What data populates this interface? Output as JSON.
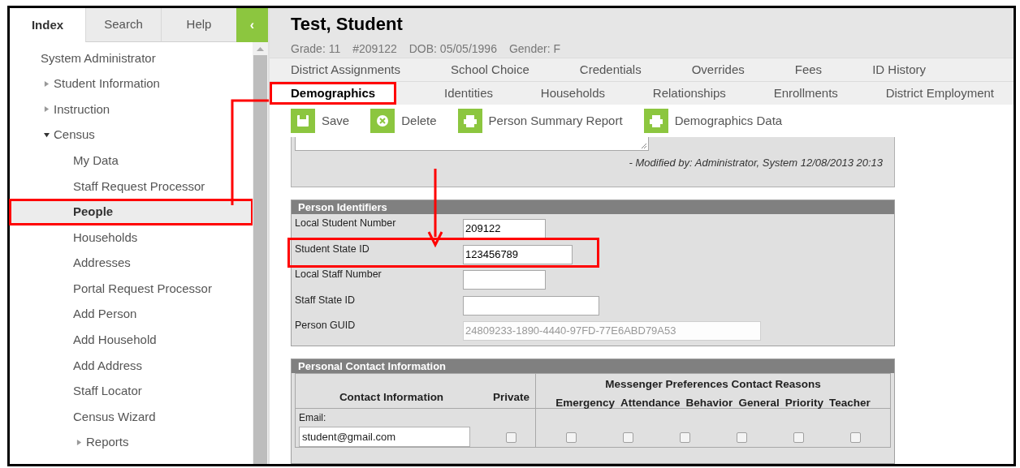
{
  "sidebar": {
    "tabs": [
      {
        "label": "Index",
        "selected": true
      },
      {
        "label": "Search",
        "selected": false
      },
      {
        "label": "Help",
        "selected": false
      }
    ],
    "collapse_button": "‹",
    "items": [
      {
        "label": "System Administrator",
        "kind": "page",
        "selected": false,
        "highlighted": false
      },
      {
        "label": "Student Information",
        "kind": "folder",
        "expanded": false,
        "selected": false,
        "highlighted": false
      },
      {
        "label": "Instruction",
        "kind": "folder",
        "expanded": false,
        "selected": false,
        "highlighted": false
      },
      {
        "label": "Census",
        "kind": "folder",
        "expanded": true,
        "selected": false,
        "highlighted": false,
        "children": [
          {
            "label": "My Data",
            "kind": "page",
            "selected": false,
            "highlighted": false
          },
          {
            "label": "Staff Request Processor",
            "kind": "page",
            "selected": false,
            "highlighted": false
          },
          {
            "label": "People",
            "kind": "page",
            "selected": true,
            "highlighted": true
          },
          {
            "label": "Households",
            "kind": "page",
            "selected": false,
            "highlighted": false
          },
          {
            "label": "Addresses",
            "kind": "page",
            "selected": false,
            "highlighted": false
          },
          {
            "label": "Portal Request Processor",
            "kind": "page",
            "selected": false,
            "highlighted": false
          },
          {
            "label": "Add Person",
            "kind": "page",
            "selected": false,
            "highlighted": false
          },
          {
            "label": "Add Household",
            "kind": "page",
            "selected": false,
            "highlighted": false
          },
          {
            "label": "Add Address",
            "kind": "page",
            "selected": false,
            "highlighted": false
          },
          {
            "label": "Staff Locator",
            "kind": "page",
            "selected": false,
            "highlighted": false
          },
          {
            "label": "Census Wizard",
            "kind": "page",
            "selected": false,
            "highlighted": false
          },
          {
            "label": "Reports",
            "kind": "folder",
            "expanded": false,
            "selected": false,
            "highlighted": false
          }
        ]
      }
    ]
  },
  "header": {
    "name": "Test, Student",
    "details": [
      "Grade: 11",
      "#209122",
      "DOB: 05/05/1996",
      "Gender: F"
    ]
  },
  "tab_rows": [
    [
      {
        "label": "District Assignments",
        "selected": false,
        "highlighted": false
      },
      {
        "label": "School Choice",
        "selected": false,
        "highlighted": false
      },
      {
        "label": "Credentials",
        "selected": false,
        "highlighted": false
      },
      {
        "label": "Overrides",
        "selected": false,
        "highlighted": false
      },
      {
        "label": "Fees",
        "selected": false,
        "highlighted": false
      },
      {
        "label": "ID History",
        "selected": false,
        "highlighted": false
      }
    ],
    [
      {
        "label": "Demographics",
        "selected": true,
        "highlighted": true
      },
      {
        "label": "Identities",
        "selected": false,
        "highlighted": false
      },
      {
        "label": "Households",
        "selected": false,
        "highlighted": false
      },
      {
        "label": "Relationships",
        "selected": false,
        "highlighted": false
      },
      {
        "label": "Enrollments",
        "selected": false,
        "highlighted": false
      },
      {
        "label": "District Employment",
        "selected": false,
        "highlighted": false
      }
    ]
  ],
  "toolbar": [
    {
      "label": "Save",
      "kind": "save"
    },
    {
      "label": "Delete",
      "kind": "delete"
    },
    {
      "label": "Person Summary Report",
      "kind": "print"
    },
    {
      "label": "Demographics Data",
      "kind": "print"
    }
  ],
  "comments": {
    "modified": "- Modified by: Administrator, System 12/08/2013 20:13"
  },
  "person_identifiers": {
    "title": "Person Identifiers",
    "fields": [
      {
        "label": "Local Student Number",
        "value": "209122",
        "disabled": false,
        "highlighted": false
      },
      {
        "label": "Student State ID",
        "value": "123456789",
        "disabled": false,
        "highlighted": true
      },
      {
        "label": "Local Staff Number",
        "disabled": false,
        "highlighted": false
      },
      {
        "label": "Staff State ID",
        "disabled": false,
        "highlighted": false
      },
      {
        "label": "Person GUID",
        "value": "24809233-1890-4440-97FD-77E6ABD79A53",
        "disabled": true,
        "highlighted": false
      }
    ]
  },
  "contact": {
    "title": "Personal Contact Information",
    "group_heading": "Messenger Preferences Contact Reasons",
    "columns": [
      "Contact Information",
      "Private"
    ],
    "reasons": [
      "Emergency",
      "Attendance",
      "Behavior",
      "General",
      "Priority",
      "Teacher"
    ],
    "rows": [
      {
        "label": "Email:",
        "value": "student@gmail.com",
        "private": false,
        "reasons": [
          false,
          false,
          false,
          false,
          false,
          false
        ]
      }
    ]
  }
}
